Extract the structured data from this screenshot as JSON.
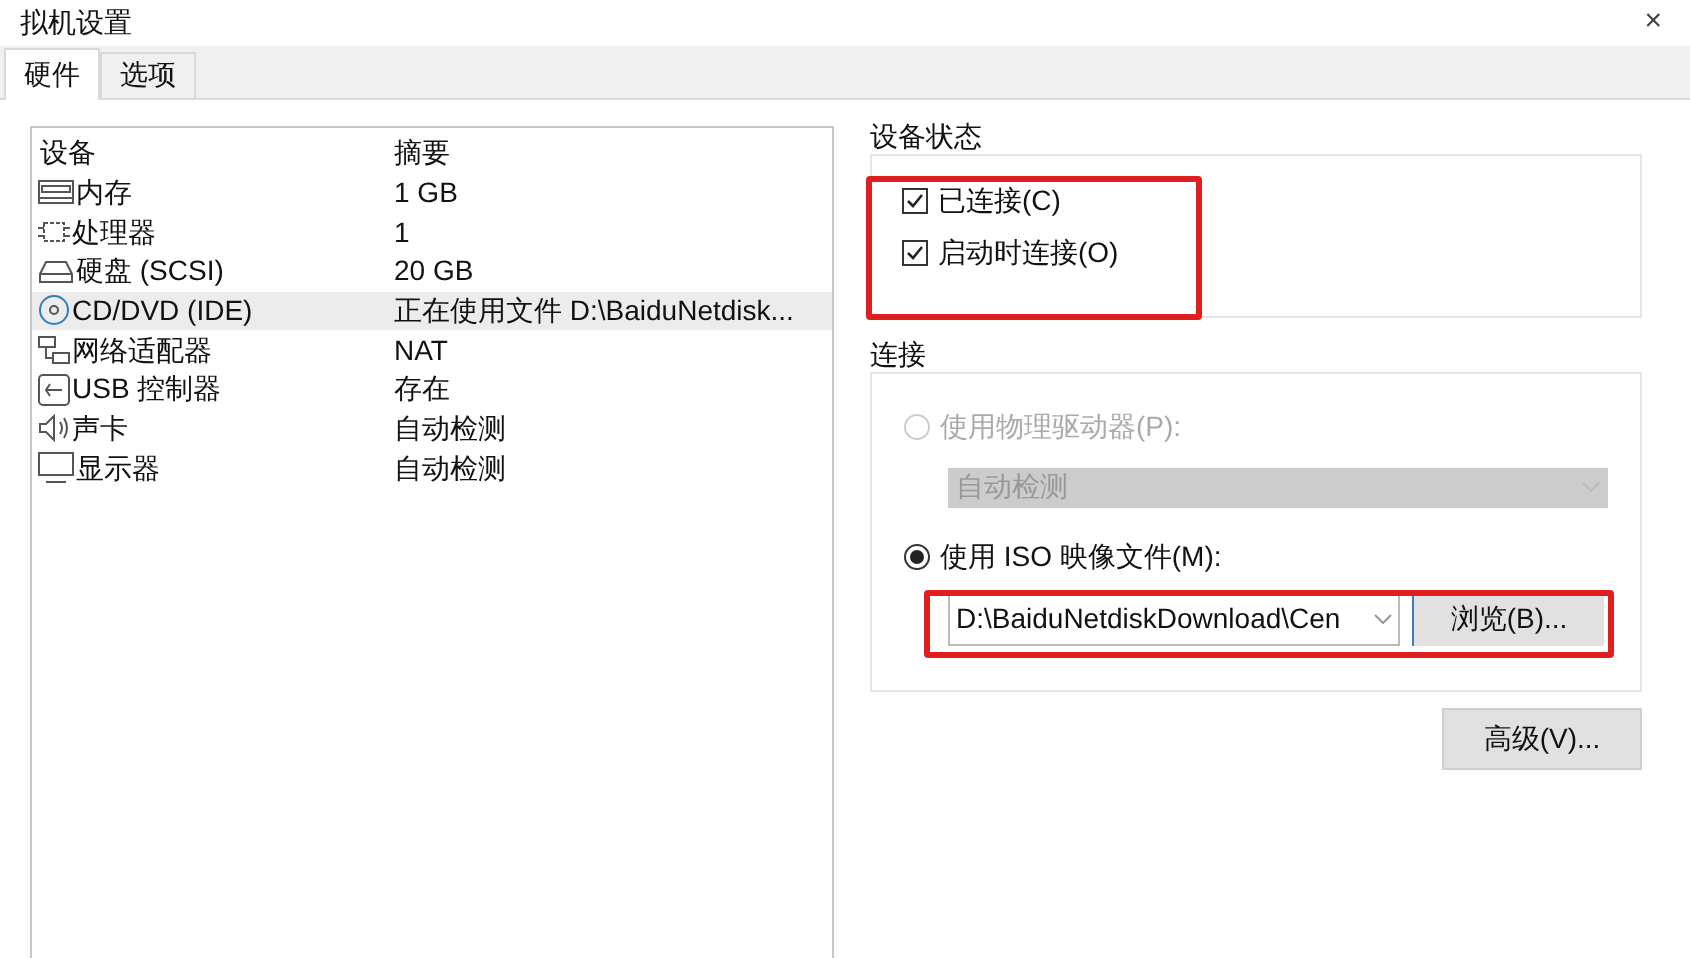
{
  "window": {
    "title": "拟机设置",
    "close": "×"
  },
  "tabs": [
    {
      "label": "硬件",
      "selected": true
    },
    {
      "label": "选项",
      "selected": false
    }
  ],
  "device_table": {
    "columns": [
      "设备",
      "摘要"
    ],
    "rows": [
      {
        "device": "内存",
        "summary": "1 GB",
        "selected": false
      },
      {
        "device": "处理器",
        "summary": "1",
        "selected": false
      },
      {
        "device": "硬盘 (SCSI)",
        "summary": "20 GB",
        "selected": false
      },
      {
        "device": "CD/DVD (IDE)",
        "summary": "正在使用文件 D:\\BaiduNetdisk...",
        "selected": true
      },
      {
        "device": "网络适配器",
        "summary": "NAT",
        "selected": false
      },
      {
        "device": "USB 控制器",
        "summary": "存在",
        "selected": false
      },
      {
        "device": "声卡",
        "summary": "自动检测",
        "selected": false
      },
      {
        "device": "显示器",
        "summary": "自动检测",
        "selected": false
      }
    ]
  },
  "device_status": {
    "title": "设备状态",
    "options": [
      {
        "label": "已连接(C)",
        "checked": true
      },
      {
        "label": "启动时连接(O)",
        "checked": true
      }
    ]
  },
  "connection": {
    "title": "连接",
    "physical": {
      "label": "使用物理驱动器(P):",
      "selected": false,
      "disabled": true,
      "dropdown": "自动检测"
    },
    "iso": {
      "label": "使用 ISO 映像文件(M):",
      "selected": true,
      "value": "D:\\BaiduNetdiskDownload\\Cen",
      "browse": "浏览(B)..."
    }
  },
  "advanced_button": "高级(V)..."
}
